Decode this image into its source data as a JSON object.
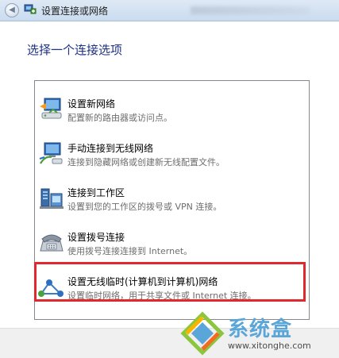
{
  "window": {
    "title": "设置连接或网络",
    "back_glyph": "◀"
  },
  "heading": "选择一个连接选项",
  "options": [
    {
      "title": "设置新网络",
      "desc": "配置新的路由器或访问点。",
      "icon": "router-icon"
    },
    {
      "title": "手动连接到无线网络",
      "desc": "连接到隐藏网络或创建新无线配置文件。",
      "icon": "wireless-network-icon"
    },
    {
      "title": "连接到工作区",
      "desc": "设置到您的工作区的拨号或 VPN 连接。",
      "icon": "workplace-icon"
    },
    {
      "title": "设置拨号连接",
      "desc": "使用拨号连接连接到 Internet。",
      "icon": "telephone-icon"
    },
    {
      "title": "设置无线临时(计算机到计算机)网络",
      "desc": "设置临时网络，用于共享文件或 Internet 连接。",
      "icon": "adhoc-network-icon"
    }
  ],
  "watermark": {
    "name": "系统盒",
    "url": "www.xitonghe.com"
  },
  "colors": {
    "heading": "#1e3287",
    "highlight": "#e0282d",
    "watermark": "#5aa6d8"
  }
}
